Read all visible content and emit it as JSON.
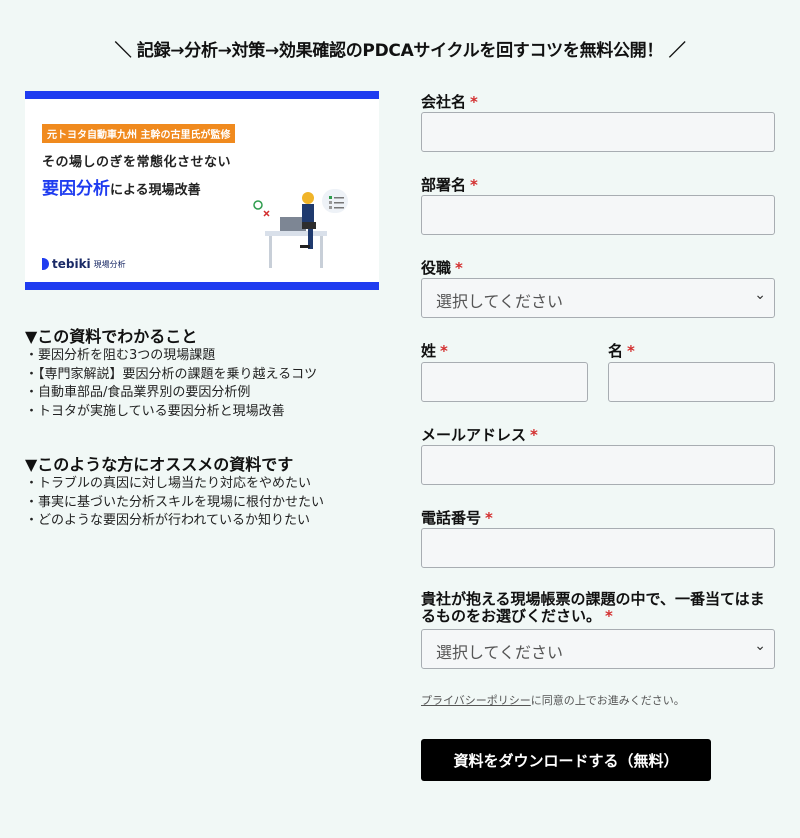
{
  "headline": "＼ 記録→分析→対策→効果確認のPDCAサイクルを回すコツを無料公開！ ／",
  "banner": {
    "tag": "元トヨタ自動車九州 主幹の古里氏が監修",
    "line1": "その場しのぎを常態化させない",
    "line2_accent": "要因分析",
    "line2_rest": "による現場改善",
    "logo_brand": "tebiki",
    "logo_sub": "現場分析"
  },
  "section1": {
    "title": "▼この資料でわかること",
    "items": [
      "・要因分析を阻む3つの現場課題",
      "・【専門家解説】要因分析の課題を乗り越えるコツ",
      "・自動車部品/食品業界別の要因分析例",
      "・トヨタが実施している要因分析と現場改善"
    ]
  },
  "section2": {
    "title": "▼このような方にオススメの資料です",
    "items": [
      "・トラブルの真因に対し場当たり対応をやめたい",
      "・事実に基づいた分析スキルを現場に根付かせたい",
      "・どのような要因分析が行われているか知りたい"
    ]
  },
  "form": {
    "required_mark": "*",
    "company_label": "会社名",
    "department_label": "部署名",
    "position_label": "役職",
    "position_value": "選択してください",
    "last_name_label": "姓",
    "first_name_label": "名",
    "email_label": "メールアドレス",
    "phone_label": "電話番号",
    "issue_label_1": "貴社が抱える現場帳票の課題の中で、一番当てはま",
    "issue_label_2": "るものをお選びください。",
    "issue_value": "選択してください",
    "privacy_link": "プライバシーポリシー",
    "privacy_rest": "に同意の上でお進みください。",
    "submit_label": "資料をダウンロードする（無料）"
  }
}
